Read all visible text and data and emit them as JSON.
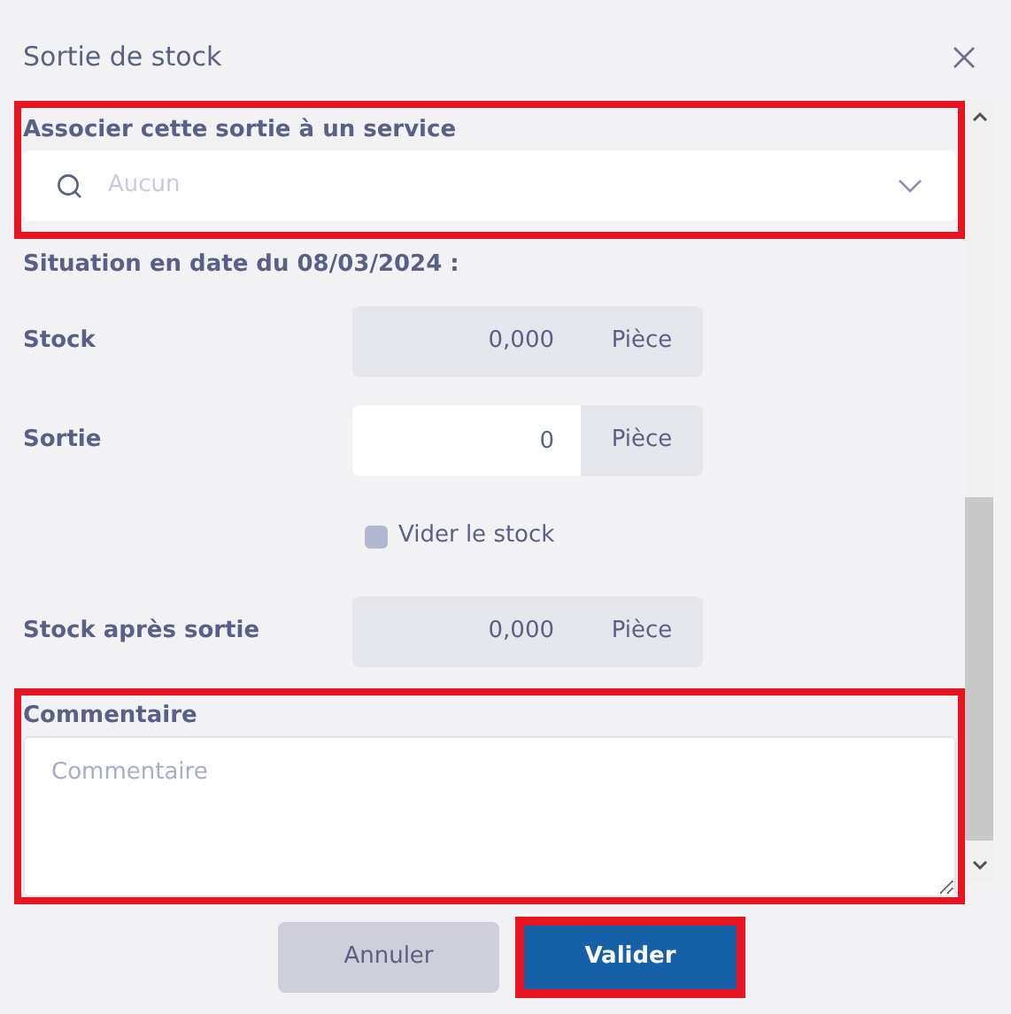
{
  "dialog": {
    "title": "Sortie de stock"
  },
  "service": {
    "label": "Associer cette sortie à un service",
    "placeholder": "Aucun",
    "highlighted": true
  },
  "situation": "Situation en date du 08/03/2024 :",
  "rows": [
    {
      "kind": "readonly",
      "label": "Stock",
      "value": "0,000",
      "unit": "Pièce"
    },
    {
      "kind": "input",
      "label": "Sortie",
      "value": "0",
      "unit": "Pièce"
    },
    {
      "kind": "checkbox",
      "label": "Vider le stock",
      "checked": false
    },
    {
      "kind": "readonly",
      "label": "Stock après sortie",
      "value": "0,000",
      "unit": "Pièce"
    }
  ],
  "comment": {
    "label": "Commentaire",
    "placeholder": "Commentaire",
    "highlighted": true
  },
  "buttons": [
    {
      "kind": "secondary",
      "label": "Annuler",
      "highlighted": false
    },
    {
      "kind": "primary",
      "label": "Valider",
      "highlighted": true
    }
  ]
}
